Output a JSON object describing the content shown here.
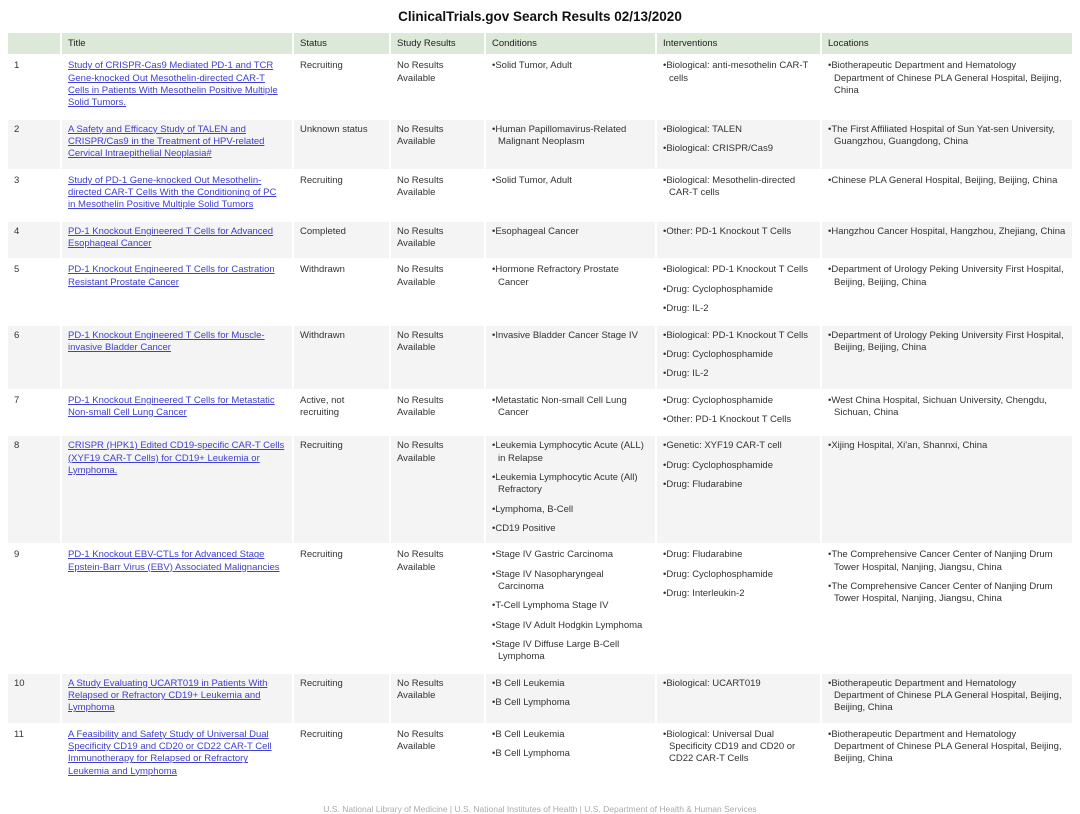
{
  "page": {
    "title": "ClinicalTrials.gov Search Results 02/13/2020",
    "footer_text": "U.S. National Library of Medicine  |  U.S. National Institutes of Health  |  U.S. Department of Health & Human Services"
  },
  "colors": {
    "header_bg": "#dce8d8",
    "alt_row_bg": "#f4f4f4",
    "link": "#4040d0",
    "footer_text": "#ababab"
  },
  "table": {
    "columns": [
      "",
      "Title",
      "Status",
      "Study Results",
      "Conditions",
      "Interventions",
      "Locations"
    ],
    "rows": [
      {
        "rank": "1",
        "title": "Study of CRISPR-Cas9 Mediated PD-1 and TCR Gene-knocked Out Mesothelin-directed CAR-T Cells in Patients With Mesothelin Positive Multiple Solid Tumors.",
        "status": "Recruiting",
        "study_results": "No Results Available",
        "conditions": [
          "Solid Tumor, Adult"
        ],
        "interventions": [
          "Biological: anti-mesothelin CAR-T cells"
        ],
        "locations": [
          "Biotherapeutic Department and Hematology Department of Chinese PLA General Hospital, Beijing, China"
        ]
      },
      {
        "rank": "2",
        "title": "A Safety and Efficacy Study of TALEN and CRISPR/Cas9 in the Treatment of HPV-related Cervical Intraepithelial Neoplasia#",
        "status": "Unknown status",
        "study_results": "No Results Available",
        "conditions": [
          "Human Papillomavirus-Related Malignant Neoplasm"
        ],
        "interventions": [
          "Biological: TALEN",
          "Biological: CRISPR/Cas9"
        ],
        "locations": [
          "The First Affiliated Hospital of Sun Yat-sen University, Guangzhou, Guangdong, China"
        ]
      },
      {
        "rank": "3",
        "title": "Study of PD-1 Gene-knocked Out Mesothelin-directed CAR-T Cells With the Conditioning of PC in Mesothelin Positive Multiple Solid Tumors",
        "status": "Recruiting",
        "study_results": "No Results Available",
        "conditions": [
          "Solid Tumor, Adult"
        ],
        "interventions": [
          "Biological: Mesothelin-directed CAR-T cells"
        ],
        "locations": [
          "Chinese PLA General Hospital, Beijing, Beijing, China"
        ]
      },
      {
        "rank": "4",
        "title": "PD-1 Knockout Engineered T Cells for Advanced Esophageal Cancer",
        "status": "Completed",
        "study_results": "No Results Available",
        "conditions": [
          "Esophageal Cancer"
        ],
        "interventions": [
          "Other: PD-1 Knockout T Cells"
        ],
        "locations": [
          "Hangzhou Cancer Hospital, Hangzhou, Zhejiang, China"
        ]
      },
      {
        "rank": "5",
        "title": "PD-1 Knockout Engineered T Cells for Castration Resistant Prostate Cancer",
        "status": "Withdrawn",
        "study_results": "No Results Available",
        "conditions": [
          "Hormone Refractory Prostate Cancer"
        ],
        "interventions": [
          "Biological: PD-1 Knockout T Cells",
          "Drug: Cyclophosphamide",
          "Drug: IL-2"
        ],
        "locations": [
          "Department of Urology Peking University First Hospital, Beijing, Beijing, China"
        ]
      },
      {
        "rank": "6",
        "title": "PD-1 Knockout Engineered T Cells for Muscle-invasive Bladder Cancer",
        "status": "Withdrawn",
        "study_results": "No Results Available",
        "conditions": [
          "Invasive Bladder Cancer Stage IV"
        ],
        "interventions": [
          "Biological: PD-1 Knockout T Cells",
          "Drug: Cyclophosphamide",
          "Drug: IL-2"
        ],
        "locations": [
          "Department of Urology Peking University First Hospital, Beijing, Beijing, China"
        ]
      },
      {
        "rank": "7",
        "title": "PD-1 Knockout Engineered T Cells for Metastatic Non-small Cell Lung Cancer",
        "status": "Active, not recruiting",
        "study_results": "No Results Available",
        "conditions": [
          "Metastatic Non-small Cell Lung Cancer"
        ],
        "interventions": [
          "Drug: Cyclophosphamide",
          "Other: PD-1 Knockout T Cells"
        ],
        "locations": [
          "West China Hospital, Sichuan University, Chengdu, Sichuan, China"
        ]
      },
      {
        "rank": "8",
        "title": "CRISPR (HPK1) Edited CD19-specific CAR-T Cells (XYF19 CAR-T Cells) for CD19+ Leukemia or Lymphoma.",
        "status": "Recruiting",
        "study_results": "No Results Available",
        "conditions": [
          "Leukemia Lymphocytic Acute (ALL) in Relapse",
          "Leukemia Lymphocytic Acute (All) Refractory",
          "Lymphoma, B-Cell",
          "CD19 Positive"
        ],
        "interventions": [
          "Genetic: XYF19 CAR-T cell",
          "Drug: Cyclophosphamide",
          "Drug: Fludarabine"
        ],
        "locations": [
          "Xijing Hospital, Xi'an, Shannxi, China"
        ]
      },
      {
        "rank": "9",
        "title": "PD-1 Knockout EBV-CTLs for Advanced Stage Epstein-Barr Virus (EBV) Associated Malignancies",
        "status": "Recruiting",
        "study_results": "No Results Available",
        "conditions": [
          "Stage IV Gastric Carcinoma",
          "Stage IV Nasopharyngeal Carcinoma",
          "T-Cell Lymphoma Stage IV",
          "Stage IV Adult Hodgkin Lymphoma",
          "Stage IV Diffuse Large B-Cell Lymphoma"
        ],
        "interventions": [
          "Drug: Fludarabine",
          "Drug: Cyclophosphamide",
          "Drug: Interleukin-2"
        ],
        "locations": [
          "The Comprehensive Cancer Center of Nanjing Drum Tower Hospital, Nanjing, Jiangsu, China",
          "The Comprehensive Cancer Center of Nanjing Drum Tower Hospital, Nanjing, Jiangsu, China"
        ]
      },
      {
        "rank": "10",
        "title": "A Study Evaluating UCART019 in Patients With Relapsed or Refractory CD19+ Leukemia and Lymphoma",
        "status": "Recruiting",
        "study_results": "No Results Available",
        "conditions": [
          "B Cell Leukemia",
          "B Cell Lymphoma"
        ],
        "interventions": [
          "Biological: UCART019"
        ],
        "locations": [
          "Biotherapeutic Department and Hematology Department of Chinese PLA General Hospital, Beijing, Beijing, China"
        ]
      },
      {
        "rank": "11",
        "title": "A Feasibility and Safety Study of Universal Dual Specificity CD19 and CD20 or CD22 CAR-T Cell Immunotherapy for Relapsed or Refractory Leukemia and Lymphoma",
        "status": "Recruiting",
        "study_results": "No Results Available",
        "conditions": [
          "B Cell Leukemia",
          "B Cell Lymphoma"
        ],
        "interventions": [
          "Biological: Universal Dual Specificity CD19 and CD20 or CD22 CAR-T Cells"
        ],
        "locations": [
          "Biotherapeutic Department and Hematology Department of Chinese PLA General Hospital, Beijing, Beijing, China"
        ]
      }
    ]
  }
}
